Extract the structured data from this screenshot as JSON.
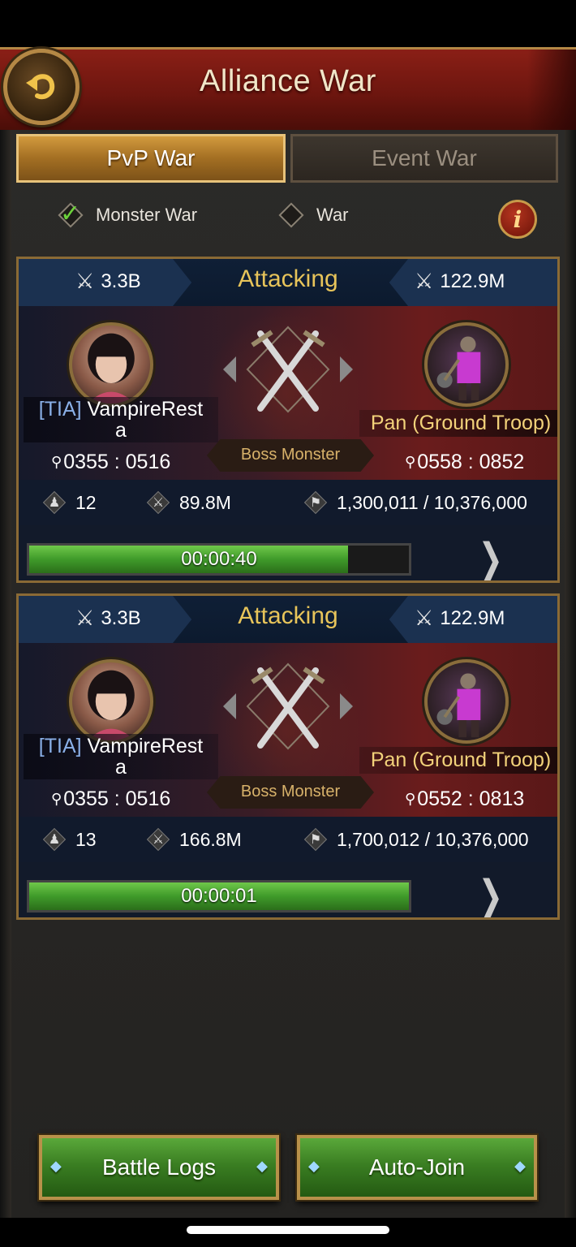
{
  "header": {
    "title": "Alliance War"
  },
  "tabs": [
    {
      "label": "PvP War",
      "active": true
    },
    {
      "label": "Event War",
      "active": false
    }
  ],
  "filters": [
    {
      "label": "Monster War",
      "checked": true
    },
    {
      "label": "War",
      "checked": false
    }
  ],
  "battles": [
    {
      "status": "Attacking",
      "attacker_power": "3.3B",
      "defender_power": "122.9M",
      "attacker": {
        "tag": "[TIA]",
        "name": "VampireRest",
        "name_wrap": "a",
        "coords": "0355 : 0516"
      },
      "defender": {
        "name": "Pan (Ground Troop)",
        "coords": "0558 : 0852"
      },
      "target_type": "Boss Monster",
      "members": "12",
      "troop_power": "89.8M",
      "troops": "1,300,011 / 10,376,000",
      "timer": "00:00:40",
      "progress": 0.84
    },
    {
      "status": "Attacking",
      "attacker_power": "3.3B",
      "defender_power": "122.9M",
      "attacker": {
        "tag": "[TIA]",
        "name": "VampireRest",
        "name_wrap": "a",
        "coords": "0355 : 0516"
      },
      "defender": {
        "name": "Pan (Ground Troop)",
        "coords": "0552 : 0813"
      },
      "target_type": "Boss Monster",
      "members": "13",
      "troop_power": "166.8M",
      "troops": "1,700,012 / 10,376,000",
      "timer": "00:00:01",
      "progress": 1.0
    }
  ],
  "buttons": {
    "battle_logs": "Battle Logs",
    "auto_join": "Auto-Join"
  },
  "colors": {
    "accent_gold": "#e7c45a",
    "button_green": "#3a7e22",
    "header_red": "#6d160f"
  }
}
